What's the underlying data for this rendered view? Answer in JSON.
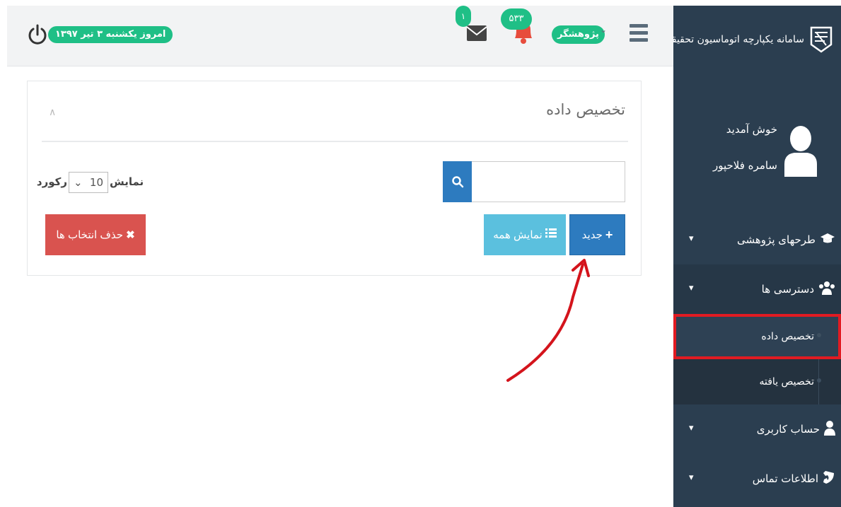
{
  "sidebar": {
    "brand_title": "سامانه یکپارچه اتوماسیون تحقیقات",
    "welcome": "خوش آمدید",
    "username": "سامره فلاحپور",
    "menu": [
      {
        "label": "طرحهای پژوهشی",
        "icon": "graduation-cap-icon"
      },
      {
        "label": "دسترسی ها",
        "icon": "users-icon"
      },
      {
        "label": "حساب کاربری",
        "icon": "user-icon"
      },
      {
        "label": "اطلاعات تماس",
        "icon": "phone-icon"
      }
    ],
    "submenu": [
      {
        "label": "تخصیص داده",
        "active": true
      },
      {
        "label": "تخصیص یافته",
        "active": false
      }
    ]
  },
  "topbar": {
    "date": "امروز یکشنبه ۳ تیر ۱۳۹۷",
    "mail_count": "۱",
    "notification_count": "۵۳۳",
    "role": "پژوهشگر"
  },
  "panel": {
    "title": "تخصیص داده",
    "search_placeholder": "",
    "length_label_right": "نمایش",
    "length_value": "10",
    "length_label_left": "رکورد",
    "new_label": "جدید",
    "show_all_label": "نمایش همه",
    "delete_label": "حذف انتخاب ها"
  },
  "colors": {
    "sidebar": "#2b3e50",
    "accent_green": "#1fbf86",
    "primary": "#2d7bbf",
    "info": "#5bc0de",
    "danger": "#d9534f",
    "highlight": "#e11b22"
  }
}
